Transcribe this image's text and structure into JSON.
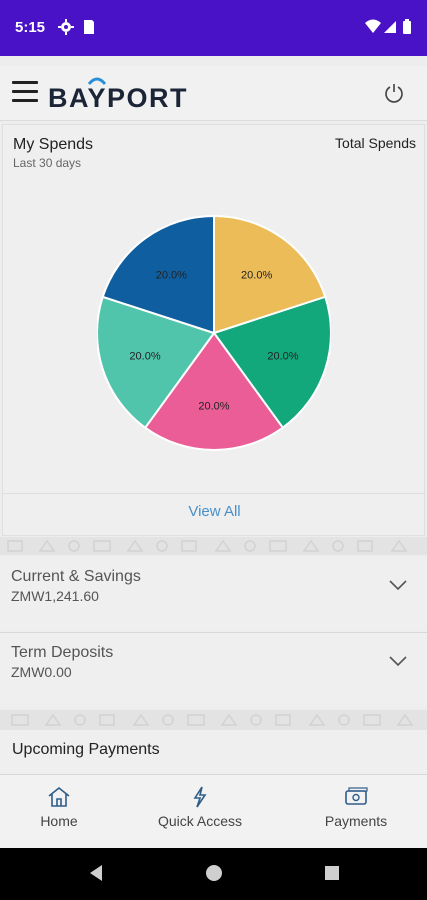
{
  "status_bar": {
    "time": "5:15",
    "icons": [
      "gear-icon",
      "sim-icon",
      "wifi-icon",
      "signal-icon",
      "battery-icon"
    ]
  },
  "header": {
    "brand": "BAYPORT",
    "menu_icon": "hamburger-icon",
    "power_icon": "power-icon"
  },
  "spends": {
    "title": "My Spends",
    "period": "Last 30 days",
    "total_label": "Total Spends",
    "view_all": "View All"
  },
  "chart_data": {
    "type": "pie",
    "values": [
      20.0,
      20.0,
      20.0,
      20.0,
      20.0
    ],
    "labels": [
      "20.0%",
      "20.0%",
      "20.0%",
      "20.0%",
      "20.0%"
    ],
    "colors": [
      "#ebbc58",
      "#13a87b",
      "#eb5d97",
      "#51c4ac",
      "#0f5fa0"
    ]
  },
  "accounts": [
    {
      "name": "Current & Savings",
      "balance": "ZMW1,241.60"
    },
    {
      "name": "Term Deposits",
      "balance": "ZMW0.00"
    }
  ],
  "upcoming": {
    "title": "Upcoming Payments"
  },
  "bottom_nav": [
    {
      "label": "Home",
      "icon": "home-icon"
    },
    {
      "label": "Quick Access",
      "icon": "lightning-icon"
    },
    {
      "label": "Payments",
      "icon": "payment-icon"
    }
  ],
  "system_nav": [
    "back-icon",
    "home-circle-icon",
    "recents-icon"
  ]
}
